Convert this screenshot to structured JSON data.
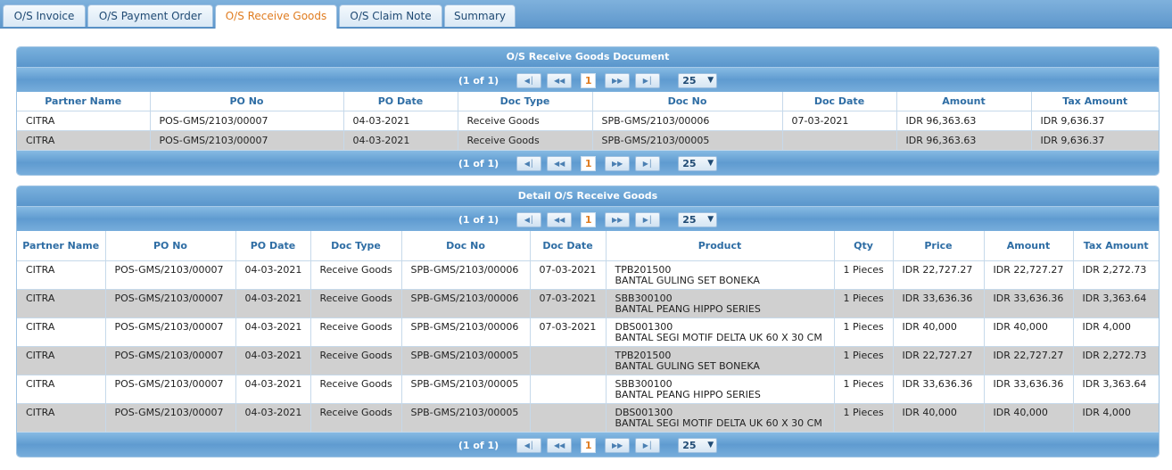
{
  "tabs": [
    {
      "label": "O/S Invoice",
      "active": false
    },
    {
      "label": "O/S Payment Order",
      "active": false
    },
    {
      "label": "O/S Receive Goods",
      "active": true
    },
    {
      "label": "O/S Claim Note",
      "active": false
    },
    {
      "label": "Summary",
      "active": false
    }
  ],
  "pager": {
    "info": "(1 of 1)",
    "first_icon": "first-page-icon",
    "prev_icon": "prev-page-icon",
    "next_icon": "next-page-icon",
    "last_icon": "last-page-icon",
    "current_page": "1",
    "page_size": "25"
  },
  "document_panel": {
    "title": "O/S Receive Goods Document",
    "headers": [
      "Partner Name",
      "PO No",
      "PO Date",
      "Doc Type",
      "Doc No",
      "Doc Date",
      "Amount",
      "Tax Amount"
    ],
    "rows": [
      [
        "CITRA",
        "POS-GMS/2103/00007",
        "04-03-2021",
        "Receive Goods",
        "SPB-GMS/2103/00006",
        "07-03-2021",
        "IDR 96,363.63",
        "IDR 9,636.37"
      ],
      [
        "CITRA",
        "POS-GMS/2103/00007",
        "04-03-2021",
        "Receive Goods",
        "SPB-GMS/2103/00005",
        "",
        "IDR 96,363.63",
        "IDR 9,636.37"
      ]
    ]
  },
  "detail_panel": {
    "title": "Detail O/S Receive Goods",
    "headers": [
      "Partner Name",
      "PO No",
      "PO Date",
      "Doc Type",
      "Doc No",
      "Doc Date",
      "Product",
      "Qty",
      "Price",
      "Amount",
      "Tax Amount"
    ],
    "rows": [
      {
        "partner": "CITRA",
        "po_no": "POS-GMS/2103/00007",
        "po_date": "04-03-2021",
        "doc_type": "Receive Goods",
        "doc_no": "SPB-GMS/2103/00006",
        "doc_date": "07-03-2021",
        "product_code": "TPB201500",
        "product_name": "BANTAL GULING SET BONEKA",
        "qty": "1 Pieces",
        "price": "IDR 22,727.27",
        "amount": "IDR 22,727.27",
        "tax": "IDR 2,272.73"
      },
      {
        "partner": "CITRA",
        "po_no": "POS-GMS/2103/00007",
        "po_date": "04-03-2021",
        "doc_type": "Receive Goods",
        "doc_no": "SPB-GMS/2103/00006",
        "doc_date": "07-03-2021",
        "product_code": "SBB300100",
        "product_name": "BANTAL PEANG HIPPO SERIES",
        "qty": "1 Pieces",
        "price": "IDR 33,636.36",
        "amount": "IDR 33,636.36",
        "tax": "IDR 3,363.64"
      },
      {
        "partner": "CITRA",
        "po_no": "POS-GMS/2103/00007",
        "po_date": "04-03-2021",
        "doc_type": "Receive Goods",
        "doc_no": "SPB-GMS/2103/00006",
        "doc_date": "07-03-2021",
        "product_code": "DBS001300",
        "product_name": "BANTAL SEGI MOTIF DELTA UK 60 X 30 CM",
        "qty": "1 Pieces",
        "price": "IDR 40,000",
        "amount": "IDR 40,000",
        "tax": "IDR 4,000"
      },
      {
        "partner": "CITRA",
        "po_no": "POS-GMS/2103/00007",
        "po_date": "04-03-2021",
        "doc_type": "Receive Goods",
        "doc_no": "SPB-GMS/2103/00005",
        "doc_date": "",
        "product_code": "TPB201500",
        "product_name": "BANTAL GULING SET BONEKA",
        "qty": "1 Pieces",
        "price": "IDR 22,727.27",
        "amount": "IDR 22,727.27",
        "tax": "IDR 2,272.73"
      },
      {
        "partner": "CITRA",
        "po_no": "POS-GMS/2103/00007",
        "po_date": "04-03-2021",
        "doc_type": "Receive Goods",
        "doc_no": "SPB-GMS/2103/00005",
        "doc_date": "",
        "product_code": "SBB300100",
        "product_name": "BANTAL PEANG HIPPO SERIES",
        "qty": "1 Pieces",
        "price": "IDR 33,636.36",
        "amount": "IDR 33,636.36",
        "tax": "IDR 3,363.64"
      },
      {
        "partner": "CITRA",
        "po_no": "POS-GMS/2103/00007",
        "po_date": "04-03-2021",
        "doc_type": "Receive Goods",
        "doc_no": "SPB-GMS/2103/00005",
        "doc_date": "",
        "product_code": "DBS001300",
        "product_name": "BANTAL SEGI MOTIF DELTA UK 60 X 30 CM",
        "qty": "1 Pieces",
        "price": "IDR 40,000",
        "amount": "IDR 40,000",
        "tax": "IDR 4,000"
      }
    ]
  },
  "colors": {
    "accent": "#e07c20",
    "header_text": "#2e6da4",
    "panel_blue": "#5e97cc",
    "alt_row": "#d0d0d0"
  }
}
